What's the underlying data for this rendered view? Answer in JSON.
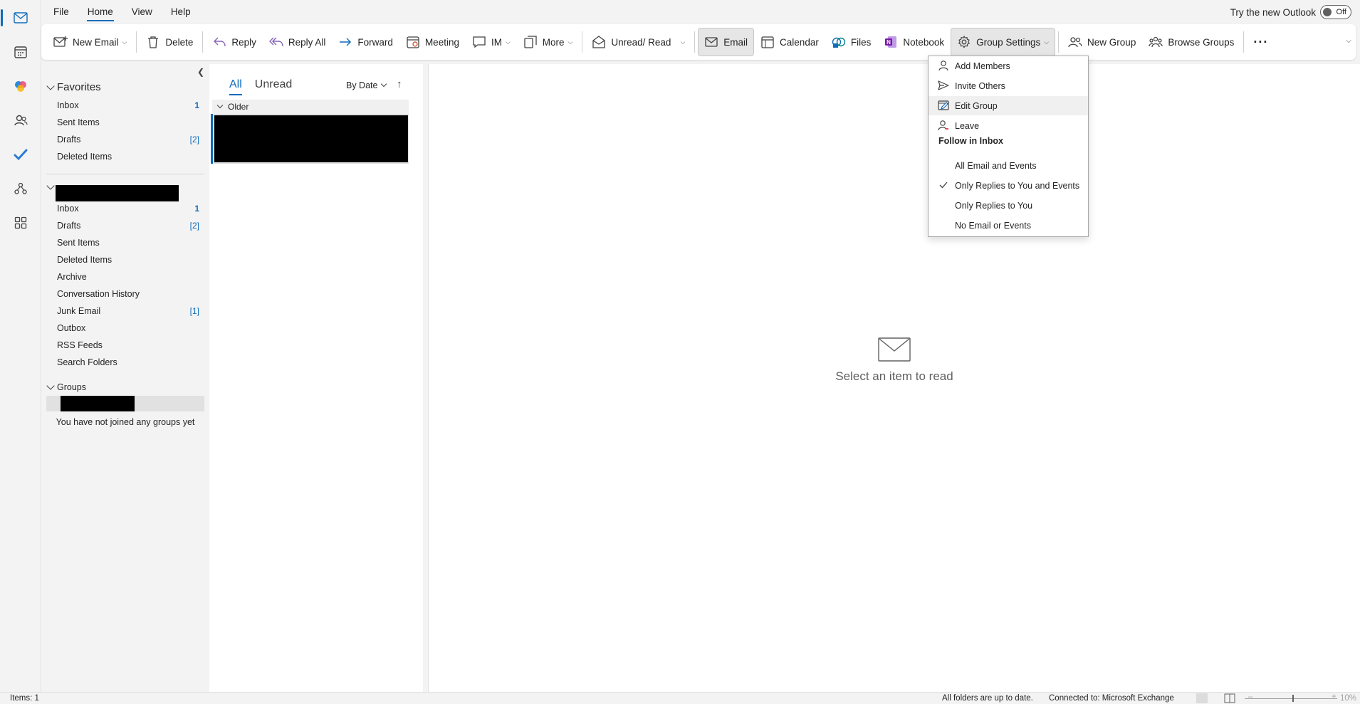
{
  "menu": {
    "tabs": [
      "File",
      "Home",
      "View",
      "Help"
    ],
    "active": "Home"
  },
  "try_new": {
    "label": "Try the new Outlook",
    "toggle": "Off"
  },
  "ribbon": {
    "new_email": "New Email",
    "delete": "Delete",
    "reply": "Reply",
    "reply_all": "Reply All",
    "forward": "Forward",
    "meeting": "Meeting",
    "im": "IM",
    "more": "More",
    "unread_read": "Unread/ Read",
    "email": "Email",
    "calendar": "Calendar",
    "files": "Files",
    "notebook": "Notebook",
    "group_settings": "Group Settings",
    "new_group": "New Group",
    "browse_groups": "Browse Groups",
    "overflow": "···"
  },
  "favorites": {
    "title": "Favorites",
    "items": [
      {
        "label": "Inbox",
        "count": "1"
      },
      {
        "label": "Sent Items",
        "count": ""
      },
      {
        "label": "Drafts",
        "count": "[2]"
      },
      {
        "label": "Deleted Items",
        "count": ""
      }
    ]
  },
  "account": {
    "items": [
      {
        "label": "Inbox",
        "count": "1"
      },
      {
        "label": "Drafts",
        "count": "[2]"
      },
      {
        "label": "Sent Items",
        "count": ""
      },
      {
        "label": "Deleted Items",
        "count": ""
      },
      {
        "label": "Archive",
        "count": ""
      },
      {
        "label": "Conversation History",
        "count": ""
      },
      {
        "label": "Junk Email",
        "count": "[1]"
      },
      {
        "label": "Outbox",
        "count": ""
      },
      {
        "label": "RSS Feeds",
        "count": ""
      },
      {
        "label": "Search Folders",
        "count": ""
      }
    ]
  },
  "groups": {
    "title": "Groups",
    "empty_text": "You have not joined any groups yet"
  },
  "message_list": {
    "tabs": [
      "All",
      "Unread"
    ],
    "active_tab": "All",
    "sort": "By Date",
    "group_header": "Older"
  },
  "reading_pane": {
    "empty_text": "Select an item to read"
  },
  "group_settings_menu": {
    "items": [
      {
        "label": "Add Members",
        "icon": "person-icon"
      },
      {
        "label": "Invite Others",
        "icon": "send-icon"
      },
      {
        "label": "Edit Group",
        "icon": "edit-group-icon"
      },
      {
        "label": "Leave",
        "icon": "person-leave-icon"
      }
    ],
    "follow_heading": "Follow in Inbox",
    "follow_options": [
      {
        "label": "All Email and Events",
        "checked": false
      },
      {
        "label": "Only Replies to You and Events",
        "checked": true
      },
      {
        "label": "Only Replies to You",
        "checked": false
      },
      {
        "label": "No Email or Events",
        "checked": false
      }
    ]
  },
  "status": {
    "items": "Items: 1",
    "sync": "All folders are up to date.",
    "connection": "Connected to: Microsoft Exchange",
    "zoom": "10%"
  }
}
